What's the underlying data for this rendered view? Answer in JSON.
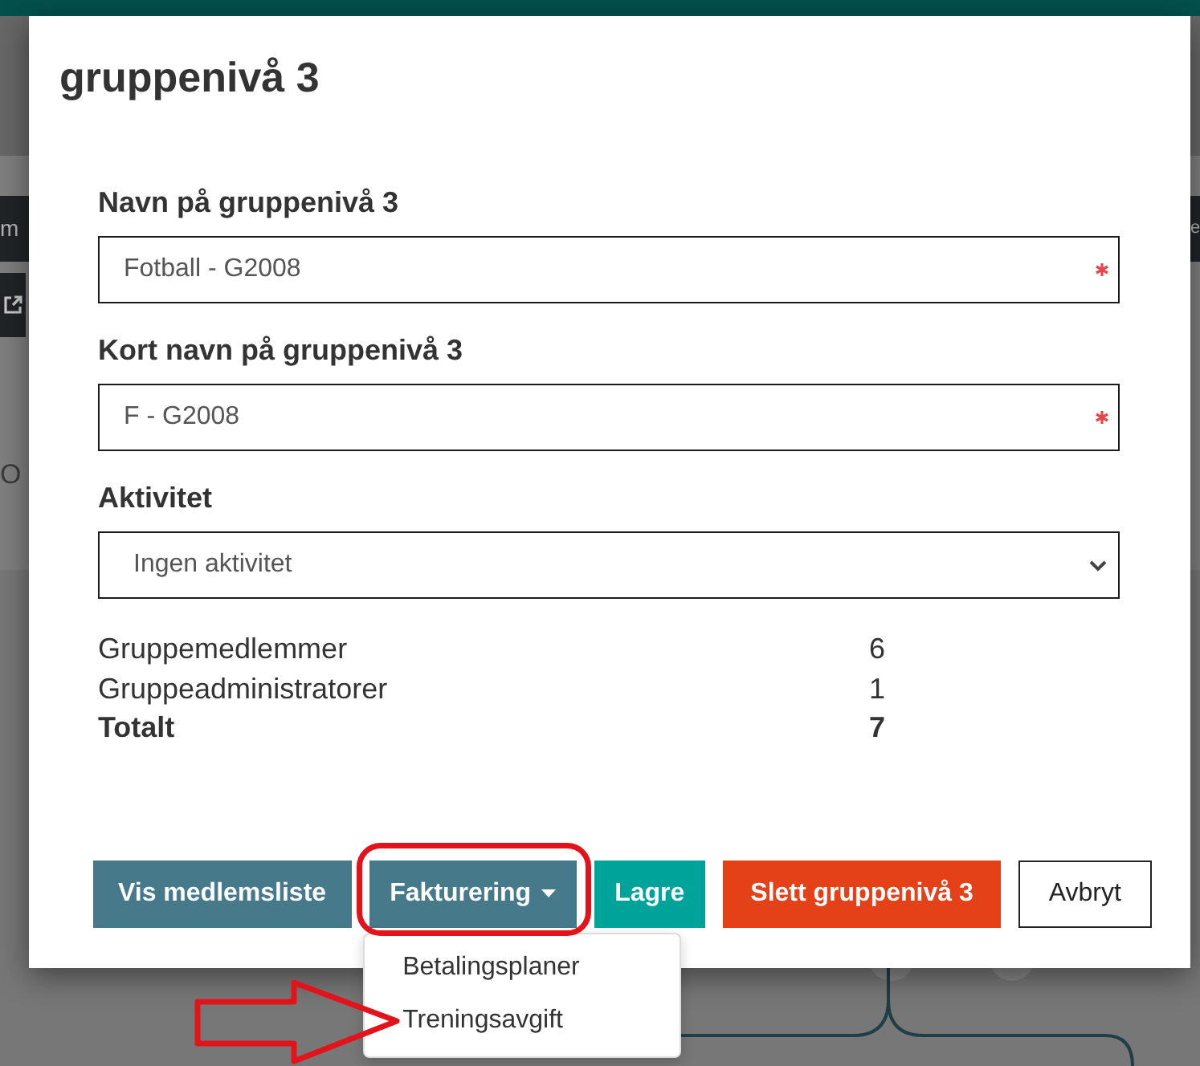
{
  "background_page": {
    "left_tab": "m",
    "right_tab": "e",
    "side_text": "O"
  },
  "dialog": {
    "title": "gruppenivå 3",
    "fields": [
      {
        "kind": "text",
        "label": "Navn på gruppenivå 3",
        "value": "Fotball - G2008",
        "required": true
      },
      {
        "kind": "text",
        "label": "Kort navn på gruppenivå 3",
        "value": "F - G2008",
        "required": true
      },
      {
        "kind": "select",
        "label": "Aktivitet",
        "value": "Ingen aktivitet",
        "required": false
      }
    ],
    "stats": [
      {
        "label": "Gruppemedlemmer",
        "value": "6",
        "total": false
      },
      {
        "label": "Gruppeadministratorer",
        "value": "1",
        "total": false
      },
      {
        "label": "Totalt",
        "value": "7",
        "total": true
      }
    ],
    "buttons": [
      {
        "kind": "primary",
        "label": "Vis medlemsliste"
      },
      {
        "kind": "dropdown",
        "label": "Fakturering",
        "expanded": true,
        "menu": [
          "Betalingsplaner",
          "Treningsavgift"
        ]
      },
      {
        "kind": "save",
        "label": "Lagre"
      },
      {
        "kind": "danger",
        "label": "Slett gruppenivå 3"
      },
      {
        "kind": "cancel",
        "label": "Avbryt"
      }
    ]
  }
}
